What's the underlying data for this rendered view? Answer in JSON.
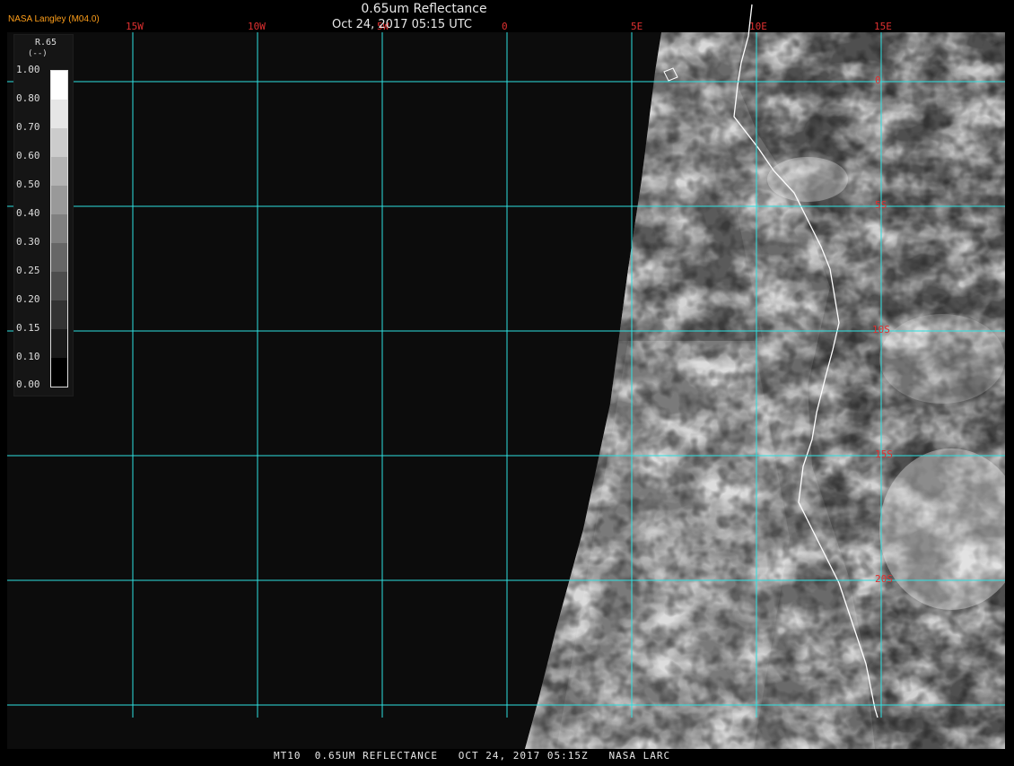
{
  "header": {
    "brand": "NASA Langley (M04.0)",
    "title": "0.65um Reflectance",
    "timestamp": "Oct 24, 2017 05:15 UTC"
  },
  "map": {
    "lon_labels": [
      "15W",
      "10W",
      "5W",
      "0",
      "5E",
      "10E",
      "15E"
    ],
    "lat_labels": [
      "0",
      "5S",
      "10S",
      "15S",
      "20S"
    ],
    "grid_color": "#2ee0e0",
    "label_color": "#e03030",
    "coastline_color": "#ffffff"
  },
  "legend": {
    "title": "R.65",
    "unit": "(--)",
    "ticks": [
      "1.00",
      "0.80",
      "0.70",
      "0.60",
      "0.50",
      "0.40",
      "0.30",
      "0.25",
      "0.20",
      "0.15",
      "0.10",
      "0.00"
    ]
  },
  "footer": {
    "text": "MT10  0.65UM REFLECTANCE   OCT 24, 2017 05:15Z   NASA LARC"
  },
  "colors": {
    "background": "#000000",
    "no_data": "#0c0c0c",
    "title_text": "#e8e8e8",
    "brand": "#ff9f1a"
  }
}
